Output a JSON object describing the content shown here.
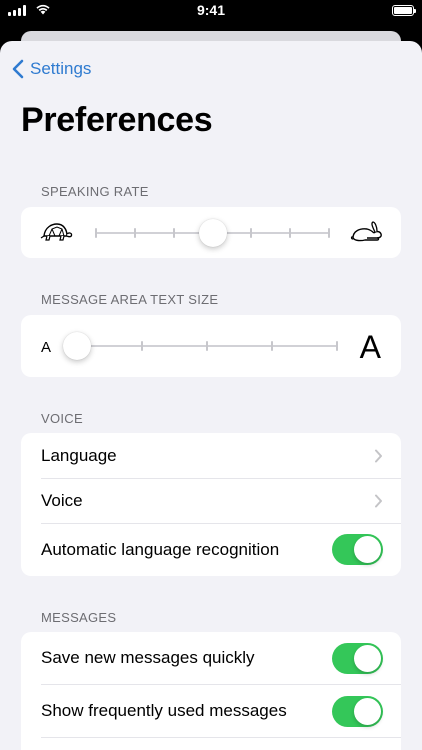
{
  "status_bar": {
    "time": "9:41",
    "battery_level": 1.0
  },
  "nav": {
    "back_label": "Settings"
  },
  "page": {
    "title": "Preferences"
  },
  "speaking_rate": {
    "header": "SPEAKING RATE",
    "slow_icon": "turtle-icon",
    "fast_icon": "rabbit-icon",
    "steps": 7,
    "selected_step": 3
  },
  "text_size": {
    "header": "MESSAGE AREA TEXT SIZE",
    "small_label": "A",
    "large_label": "A",
    "steps": 5,
    "selected_step": 0
  },
  "voice": {
    "header": "VOICE",
    "rows": [
      {
        "label": "Language",
        "accessory": "chevron"
      },
      {
        "label": "Voice",
        "accessory": "chevron"
      },
      {
        "label": "Automatic language recognition",
        "accessory": "toggle",
        "on": true
      }
    ]
  },
  "messages": {
    "header": "MESSAGES",
    "rows": [
      {
        "label": "Save new messages quickly",
        "accessory": "toggle",
        "on": true
      },
      {
        "label": "Show frequently used messages",
        "accessory": "toggle",
        "on": true
      }
    ]
  },
  "colors": {
    "accent": "#2f7bd0",
    "toggle_on": "#34c759",
    "background": "#f2f2f7"
  }
}
